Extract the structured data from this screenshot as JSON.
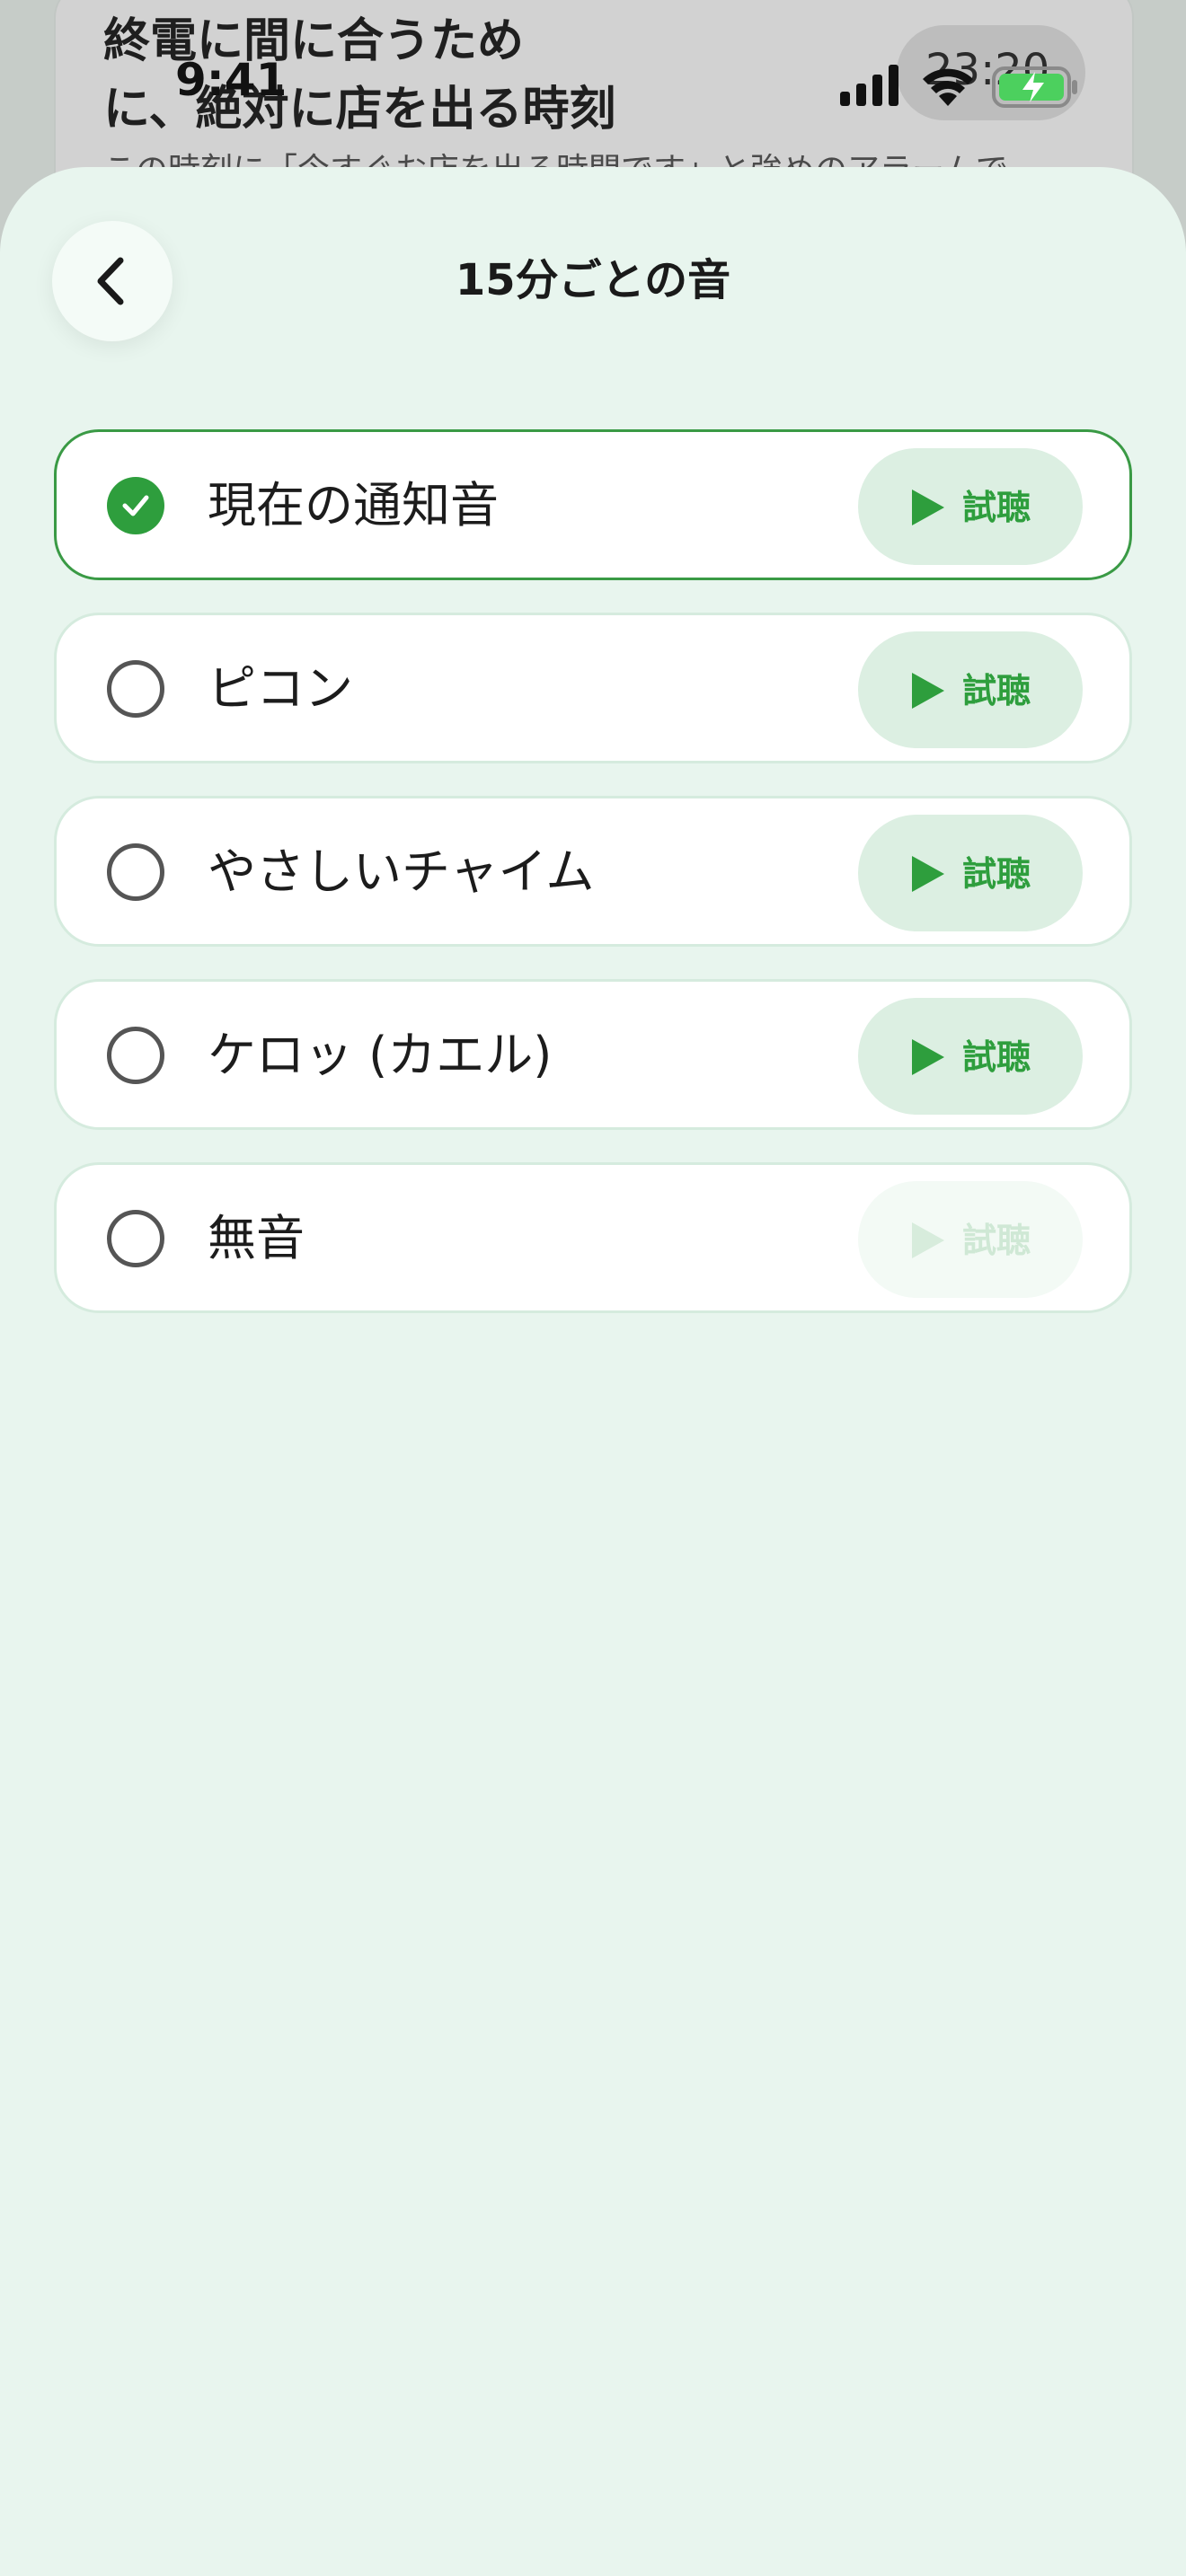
{
  "background": {
    "title": "終電に間に合うため\nに、絶対に店を出る時刻",
    "subtitle": "この時刻に「今すぐお店を出る時間です」と強めのアラームで",
    "pill_time": "23:20"
  },
  "status_bar": {
    "time": "9:41"
  },
  "sheet": {
    "title": "15分ごとの音",
    "back_icon": "chevron-left-icon"
  },
  "options": [
    {
      "label": "現在の通知音",
      "selected": true,
      "preview_label": "試聴",
      "preview_enabled": true
    },
    {
      "label": "ピコン",
      "selected": false,
      "preview_label": "試聴",
      "preview_enabled": true
    },
    {
      "label": "やさしいチャイム",
      "selected": false,
      "preview_label": "試聴",
      "preview_enabled": true
    },
    {
      "label": "ケロッ (カエル)",
      "selected": false,
      "preview_label": "試聴",
      "preview_enabled": true
    },
    {
      "label": "無音",
      "selected": false,
      "preview_label": "試聴",
      "preview_enabled": false
    }
  ],
  "colors": {
    "accent": "#2e9e3d",
    "sheet_background": "#e8f5ee",
    "preview_background": "#dcefe2"
  }
}
